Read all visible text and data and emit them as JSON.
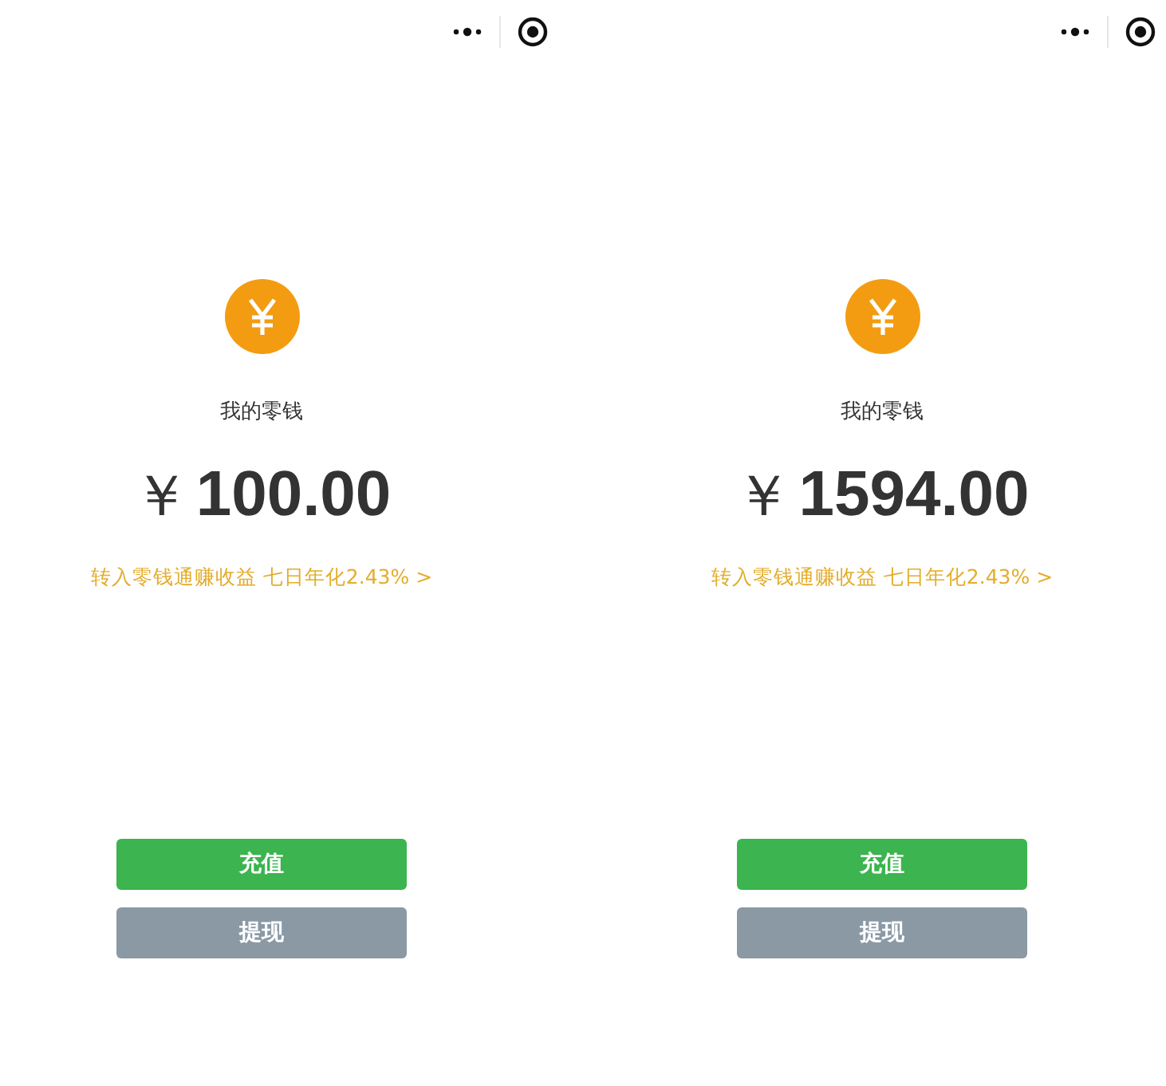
{
  "screens": [
    {
      "label": "我的零钱",
      "currency": "￥",
      "amount": "100.00",
      "promo": "转入零钱通赚收益 七日年化2.43% >",
      "buttons": [
        {
          "label": "充值",
          "kind": "primary"
        },
        {
          "label": "提现",
          "kind": "secondary"
        }
      ]
    },
    {
      "label": "我的零钱",
      "currency": "￥",
      "amount": "1594.00",
      "promo": "转入零钱通赚收益 七日年化2.43% >",
      "buttons": [
        {
          "label": "充值",
          "kind": "primary"
        },
        {
          "label": "提现",
          "kind": "secondary"
        }
      ]
    }
  ]
}
